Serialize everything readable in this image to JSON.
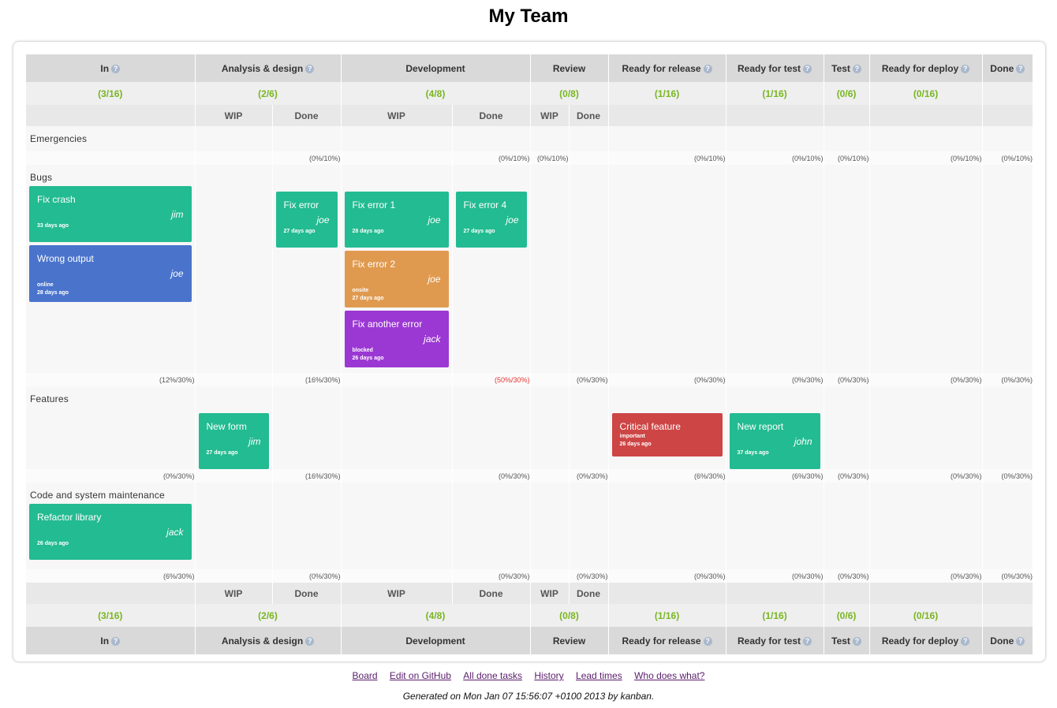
{
  "page_title": "My Team",
  "columns": [
    {
      "name": "In",
      "help": true,
      "count": "(3/16)"
    },
    {
      "name": "Analysis & design",
      "help": true,
      "count": "(2/6)"
    },
    {
      "name": "Development",
      "help": false,
      "count": "(4/8)"
    },
    {
      "name": "Review",
      "help": false,
      "count": "(0/8)"
    },
    {
      "name": "Ready for release",
      "help": true,
      "count": "(1/16)"
    },
    {
      "name": "Ready for test",
      "help": true,
      "count": "(1/16)"
    },
    {
      "name": "Test",
      "help": true,
      "count": "(0/6)"
    },
    {
      "name": "Ready for deploy",
      "help": true,
      "count": "(0/16)"
    },
    {
      "name": "Done",
      "help": true,
      "count": ""
    }
  ],
  "help_glyph": "?",
  "sub_labels": {
    "wip": "WIP",
    "done": "Done"
  },
  "lanes": [
    {
      "name": "Emergencies",
      "limits": [
        "",
        "",
        "(0%/10%)",
        "",
        "(0%/10%)",
        "(0%/10%)",
        "",
        "(0%/10%)",
        "(0%/10%)",
        "(0%/10%)",
        "(0%/10%)",
        "(0%/10%)",
        ""
      ]
    },
    {
      "name": "Bugs",
      "limits": [
        "(12%/30%)",
        "",
        "(16%/30%)",
        "",
        "(50%/30%)",
        "",
        "(0%/30%)",
        "(0%/30%)",
        "(0%/30%)",
        "(0%/30%)",
        "(0%/30%)",
        "(0%/30%)",
        ""
      ],
      "cards": {
        "in": [
          {
            "title": "Fix crash",
            "who": "jim",
            "meta1": "",
            "meta2": "33 days ago",
            "color": "#23bb91"
          },
          {
            "title": "Wrong output",
            "who": "joe",
            "meta1": "online",
            "meta2": "28 days ago",
            "color": "#4a74cc"
          }
        ],
        "ad_done": [
          {
            "title": "Fix error",
            "who": "joe",
            "meta1": "",
            "meta2": "27 days ago",
            "color": "#23bb91"
          }
        ],
        "dev_wip": [
          {
            "title": "Fix error 1",
            "who": "joe",
            "meta1": "",
            "meta2": "28 days ago",
            "color": "#23bb91"
          },
          {
            "title": "Fix error 2",
            "who": "joe",
            "meta1": "onsite",
            "meta2": "27 days ago",
            "color": "#e09a50"
          },
          {
            "title": "Fix another error",
            "who": "jack",
            "meta1": "blocked",
            "meta2": "26 days ago",
            "color": "#9b38d3"
          }
        ],
        "dev_done": [
          {
            "title": "Fix error 4",
            "who": "joe",
            "meta1": "",
            "meta2": "27 days ago",
            "color": "#23bb91"
          }
        ]
      }
    },
    {
      "name": "Features",
      "limits": [
        "(0%/30%)",
        "",
        "(16%/30%)",
        "",
        "(0%/30%)",
        "",
        "(0%/30%)",
        "(6%/30%)",
        "(6%/30%)",
        "(0%/30%)",
        "(0%/30%)",
        "(0%/30%)",
        ""
      ],
      "cards": {
        "ad_wip": [
          {
            "title": "New form",
            "who": "jim",
            "meta1": "",
            "meta2": "27 days ago",
            "color": "#23bb91"
          }
        ],
        "rfr": [
          {
            "title": "Critical feature",
            "who": "",
            "meta1": "important",
            "meta2": "26 days ago",
            "color": "#cd4545"
          }
        ],
        "rft": [
          {
            "title": "New report",
            "who": "john",
            "meta1": "",
            "meta2": "37 days ago",
            "color": "#23bb91"
          }
        ]
      }
    },
    {
      "name": "Code and system maintenance",
      "limits": [
        "(6%/30%)",
        "",
        "(0%/30%)",
        "",
        "(0%/30%)",
        "",
        "(0%/30%)",
        "(0%/30%)",
        "(0%/30%)",
        "(0%/30%)",
        "(0%/30%)",
        "(0%/30%)",
        ""
      ],
      "cards": {
        "in": [
          {
            "title": "Refactor library",
            "who": "jack",
            "meta1": "",
            "meta2": "26 days ago",
            "color": "#23bb91"
          }
        ]
      }
    }
  ],
  "footer_links": [
    "Board",
    "Edit on GitHub",
    "All done tasks",
    "History",
    "Lead times",
    "Who does what?"
  ],
  "generated": "Generated on Mon Jan 07 15:56:07 +0100 2013 by kanban."
}
